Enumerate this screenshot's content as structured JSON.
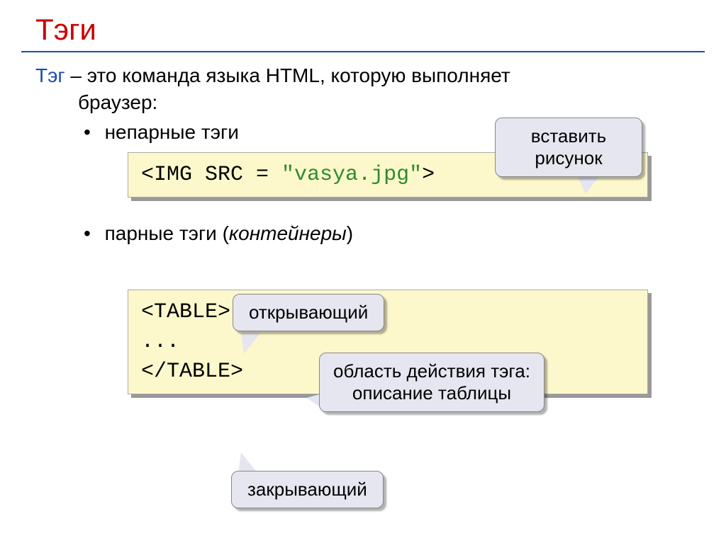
{
  "title": "Тэги",
  "term": "Тэг",
  "definition_line1": " – это команда языка HTML, которую выполняет",
  "definition_line2": "браузер:",
  "bullet1": "непарные тэги",
  "bullet2_pre": "парные тэги (",
  "bullet2_italic": "контейнеры",
  "bullet2_post": ")",
  "code1_part1": "<IMG SRC = ",
  "code1_part2": "\"vasya.jpg\"",
  "code1_part3": ">",
  "code2_line1": "<TABLE>",
  "code2_line2": "...",
  "code2_line3": "</TABLE>",
  "callouts": {
    "insert": "вставить рисунок",
    "open": "открывающий",
    "scope": "область действия тэга: описание таблицы",
    "close": "закрывающий"
  }
}
